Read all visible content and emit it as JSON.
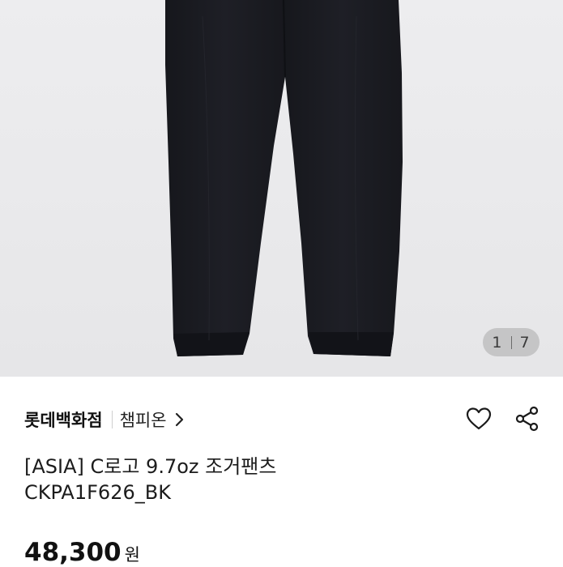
{
  "gallery": {
    "current": "1",
    "total": "7",
    "image": "black-jogger-pants-photo"
  },
  "seller": {
    "store_name": "롯데백화점",
    "brand_name": "챔피온"
  },
  "product": {
    "title_line1": "[ASIA] C로고 9.7oz 조거팬츠",
    "title_line2": "CKPA1F626_BK",
    "price": "48,300",
    "currency": "원"
  },
  "icons": {
    "wishlist": "heart-icon",
    "share": "share-icon",
    "brand_link": "chevron-right-icon"
  },
  "colors": {
    "pants": "#1b1c22",
    "background": "#ebebed",
    "counter_bg": "#bebec0"
  }
}
